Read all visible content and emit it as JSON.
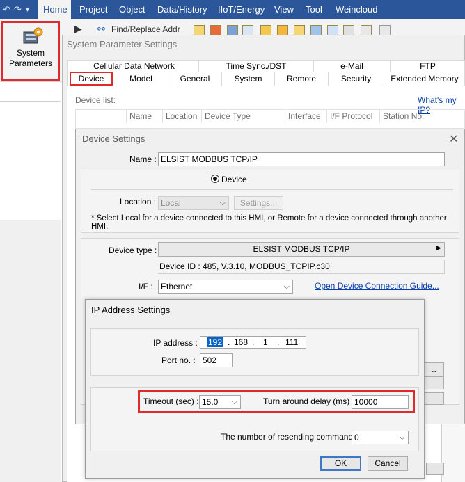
{
  "menubar": {
    "items": [
      "Home",
      "Project",
      "Object",
      "Data/History",
      "IIoT/Energy",
      "View",
      "Tool",
      "Weincloud"
    ],
    "active": "Home"
  },
  "ribbon": {
    "system_parameters_line1": "System",
    "system_parameters_line2": "Parameters",
    "find_replace": "Find/Replace Addr"
  },
  "system_window": {
    "title": "System Parameter Settings",
    "tabs_row2": [
      "Cellular Data Network",
      "Time Sync./DST",
      "e-Mail",
      "FTP"
    ],
    "tabs_row1": [
      "Device",
      "Model",
      "General",
      "System",
      "Remote",
      "Security",
      "Extended Memory"
    ],
    "active_tab": "Device",
    "device_list_label": "Device list:",
    "whats_my_ip": "What's my IP?",
    "columns": [
      "Name",
      "Location",
      "Device Type",
      "Interface",
      "I/F Protocol",
      "Station No."
    ]
  },
  "device_settings": {
    "title": "Device Settings",
    "name_label": "Name :",
    "name_value": "ELSIST MODBUS TCP/IP",
    "radio_device": "Device",
    "location_label": "Location :",
    "location_value": "Local",
    "settings_button": "Settings...",
    "location_note": "* Select Local for a device connected to this HMI, or Remote for a device connected through another HMI.",
    "device_type_label": "Device type :",
    "device_type_value": "ELSIST MODBUS TCP/IP",
    "device_id": "Device ID : 485, V.3.10, MODBUS_TCPIP.c30",
    "if_label": "I/F :",
    "if_value": "Ethernet",
    "guide_link": "Open Device Connection Guide..."
  },
  "ip_dialog": {
    "title": "IP Address Settings",
    "ip_label": "IP address :",
    "ip_octets": [
      "192",
      "168",
      "1",
      "111"
    ],
    "port_label": "Port no. :",
    "port_value": "502",
    "timeout_label": "Timeout (sec) :",
    "timeout_value": "15.0",
    "turnaround_label": "Turn around delay (ms) :",
    "turnaround_value": "10000",
    "resend_label": "The number of resending commands :",
    "resend_value": "0",
    "ok": "OK",
    "cancel": "Cancel"
  },
  "colors": {
    "ribbon_blue": "#2b579a",
    "highlight_red": "#e02b2b",
    "link_blue": "#0b3eaa"
  }
}
